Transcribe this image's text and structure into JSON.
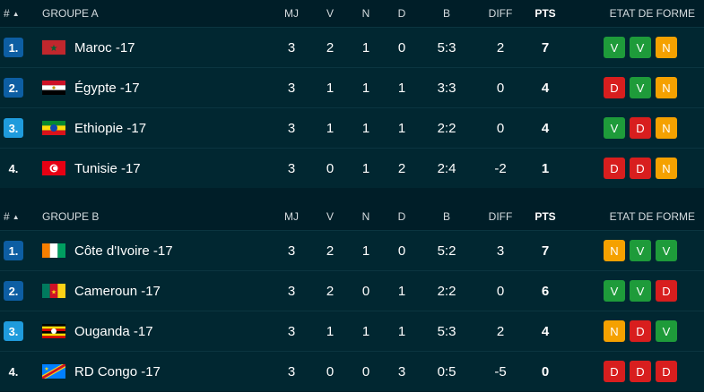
{
  "colors": {
    "win": "#1e9b3a",
    "draw": "#f5a100",
    "loss": "#d81e1e",
    "rank_q1": "#0d5ea3",
    "rank_q2": "#1f9bdc"
  },
  "columns": {
    "hash": "#",
    "mj": "MJ",
    "v": "V",
    "n": "N",
    "d": "D",
    "b": "B",
    "diff": "DIFF",
    "pts": "PTS",
    "form": "ETAT DE FORME"
  },
  "groups": [
    {
      "name": "GROUPE A",
      "rows": [
        {
          "rank": "1.",
          "rank_style": "q1",
          "flag": "maroc",
          "team": "Maroc -17",
          "mj": "3",
          "v": "2",
          "n": "1",
          "d": "0",
          "b": "5:3",
          "diff": "2",
          "pts": "7",
          "form": [
            "V",
            "V",
            "N"
          ]
        },
        {
          "rank": "2.",
          "rank_style": "q1",
          "flag": "egypte",
          "team": "Égypte -17",
          "mj": "3",
          "v": "1",
          "n": "1",
          "d": "1",
          "b": "3:3",
          "diff": "0",
          "pts": "4",
          "form": [
            "D",
            "V",
            "N"
          ]
        },
        {
          "rank": "3.",
          "rank_style": "q2",
          "flag": "ethiopie",
          "team": "Ethiopie -17",
          "mj": "3",
          "v": "1",
          "n": "1",
          "d": "1",
          "b": "2:2",
          "diff": "0",
          "pts": "4",
          "form": [
            "V",
            "D",
            "N"
          ]
        },
        {
          "rank": "4.",
          "rank_style": "none",
          "flag": "tunisie",
          "team": "Tunisie -17",
          "mj": "3",
          "v": "0",
          "n": "1",
          "d": "2",
          "b": "2:4",
          "diff": "-2",
          "pts": "1",
          "form": [
            "D",
            "D",
            "N"
          ]
        }
      ]
    },
    {
      "name": "GROUPE B",
      "rows": [
        {
          "rank": "1.",
          "rank_style": "q1",
          "flag": "cotedivoire",
          "team": "Côte d'Ivoire -17",
          "mj": "3",
          "v": "2",
          "n": "1",
          "d": "0",
          "b": "5:2",
          "diff": "3",
          "pts": "7",
          "form": [
            "N",
            "V",
            "V"
          ]
        },
        {
          "rank": "2.",
          "rank_style": "q1",
          "flag": "cameroun",
          "team": "Cameroun -17",
          "mj": "3",
          "v": "2",
          "n": "0",
          "d": "1",
          "b": "2:2",
          "diff": "0",
          "pts": "6",
          "form": [
            "V",
            "V",
            "D"
          ]
        },
        {
          "rank": "3.",
          "rank_style": "q2",
          "flag": "ouganda",
          "team": "Ouganda -17",
          "mj": "3",
          "v": "1",
          "n": "1",
          "d": "1",
          "b": "5:3",
          "diff": "2",
          "pts": "4",
          "form": [
            "N",
            "D",
            "V"
          ]
        },
        {
          "rank": "4.",
          "rank_style": "none",
          "flag": "rdcongo",
          "team": "RD Congo -17",
          "mj": "3",
          "v": "0",
          "n": "0",
          "d": "3",
          "b": "0:5",
          "diff": "-5",
          "pts": "0",
          "form": [
            "D",
            "D",
            "D"
          ]
        }
      ]
    }
  ]
}
